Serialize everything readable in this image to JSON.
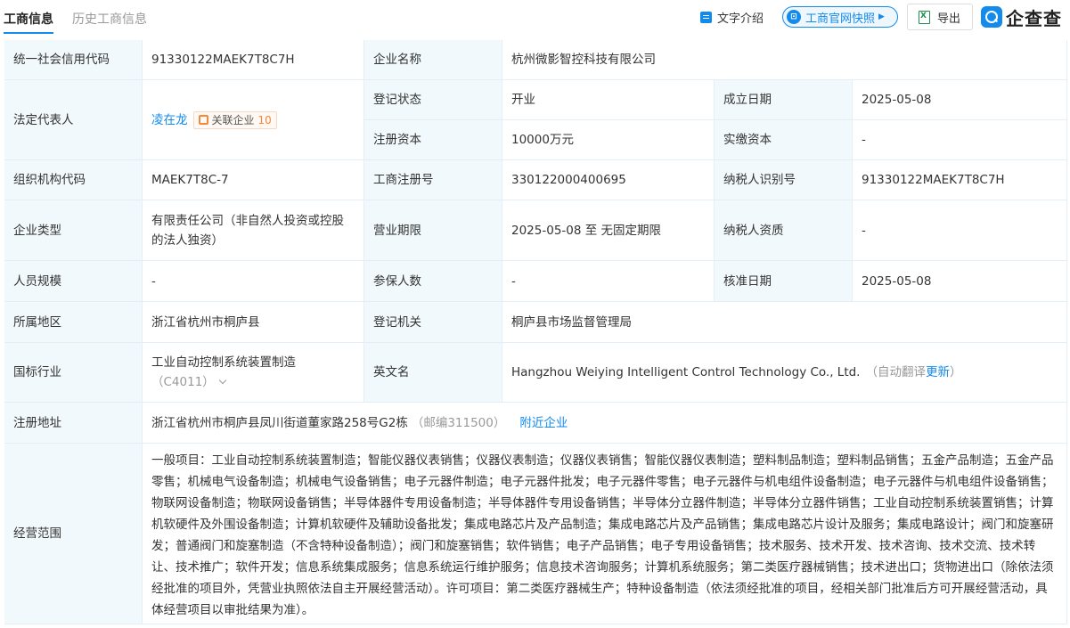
{
  "tabs": {
    "active": "工商信息",
    "inactive": "历史工商信息"
  },
  "toolbar": {
    "text_intro": "文字介绍",
    "snapshot": "工商官网快照",
    "export": "导出"
  },
  "logo": {
    "text": "企查查"
  },
  "rows": {
    "credit_code": {
      "label": "统一社会信用代码",
      "value": "91330122MAEK7T8C7H"
    },
    "company_name": {
      "label": "企业名称",
      "value": "杭州微影智控科技有限公司"
    },
    "legal_rep": {
      "label": "法定代表人",
      "name": "凌在龙",
      "badge_label": "关联企业",
      "badge_count": "10"
    },
    "reg_status": {
      "label": "登记状态",
      "value": "开业"
    },
    "est_date": {
      "label": "成立日期",
      "value": "2025-05-08"
    },
    "reg_capital": {
      "label": "注册资本",
      "value": "10000万元"
    },
    "paid_capital": {
      "label": "实缴资本",
      "value": "-"
    },
    "org_code": {
      "label": "组织机构代码",
      "value": "MAEK7T8C-7"
    },
    "reg_no": {
      "label": "工商注册号",
      "value": "330122000400695"
    },
    "taxpayer_id": {
      "label": "纳税人识别号",
      "value": "91330122MAEK7T8C7H"
    },
    "company_type": {
      "label": "企业类型",
      "value": "有限责任公司（非自然人投资或控股的法人独资）"
    },
    "business_term": {
      "label": "营业期限",
      "value": "2025-05-08 至 无固定期限"
    },
    "taxpayer_qual": {
      "label": "纳税人资质",
      "value": "-"
    },
    "staff_size": {
      "label": "人员规模",
      "value": "-"
    },
    "insured": {
      "label": "参保人数",
      "value": "-"
    },
    "approval_date": {
      "label": "核准日期",
      "value": "2025-05-08"
    },
    "region": {
      "label": "所属地区",
      "value": "浙江省杭州市桐庐县"
    },
    "reg_authority": {
      "label": "登记机关",
      "value": "桐庐县市场监督管理局"
    },
    "industry": {
      "label": "国标行业",
      "value": "工业自动控制系统装置制造",
      "code": "（C4011）"
    },
    "english_name": {
      "label": "英文名",
      "value": "Hangzhou Weiying Intelligent Control Technology Co., Ltd.",
      "note_prefix": "（自动翻译",
      "note_link": "更新",
      "note_suffix": "）"
    },
    "address": {
      "label": "注册地址",
      "value": "浙江省杭州市桐庐县凤川街道董家路258号G2栋",
      "postcode": "（邮编311500）",
      "nearby": "附近企业"
    },
    "scope": {
      "label": "经营范围",
      "value": "一般项目：工业自动控制系统装置制造；智能仪器仪表销售；仪器仪表制造；仪器仪表销售；智能仪器仪表制造；塑料制品制造；塑料制品销售；五金产品制造；五金产品零售；机械电气设备制造；机械电气设备销售；电子元器件制造；电子元器件批发；电子元器件零售；电子元器件与机电组件设备制造；电子元器件与机电组件设备销售；物联网设备制造；物联网设备销售；半导体器件专用设备制造；半导体器件专用设备销售；半导体分立器件制造；半导体分立器件销售；工业自动控制系统装置销售；计算机软硬件及外围设备制造；计算机软硬件及辅助设备批发；集成电路芯片及产品制造；集成电路芯片及产品销售；集成电路芯片设计及服务；集成电路设计；阀门和旋塞研发；普通阀门和旋塞制造（不含特种设备制造）；阀门和旋塞销售；软件销售；电子产品销售；电子专用设备销售；技术服务、技术开发、技术咨询、技术交流、技术转让、技术推广；软件开发；信息系统集成服务；信息系统运行维护服务；信息技术咨询服务；计算机系统服务；第二类医疗器械销售；技术进出口；货物进出口（除依法须经批准的项目外，凭营业执照依法自主开展经营活动）。许可项目：第二类医疗器械生产；特种设备制造（依法须经批准的项目，经相关部门批准后方可开展经营活动，具体经营项目以审批结果为准）。"
    }
  }
}
